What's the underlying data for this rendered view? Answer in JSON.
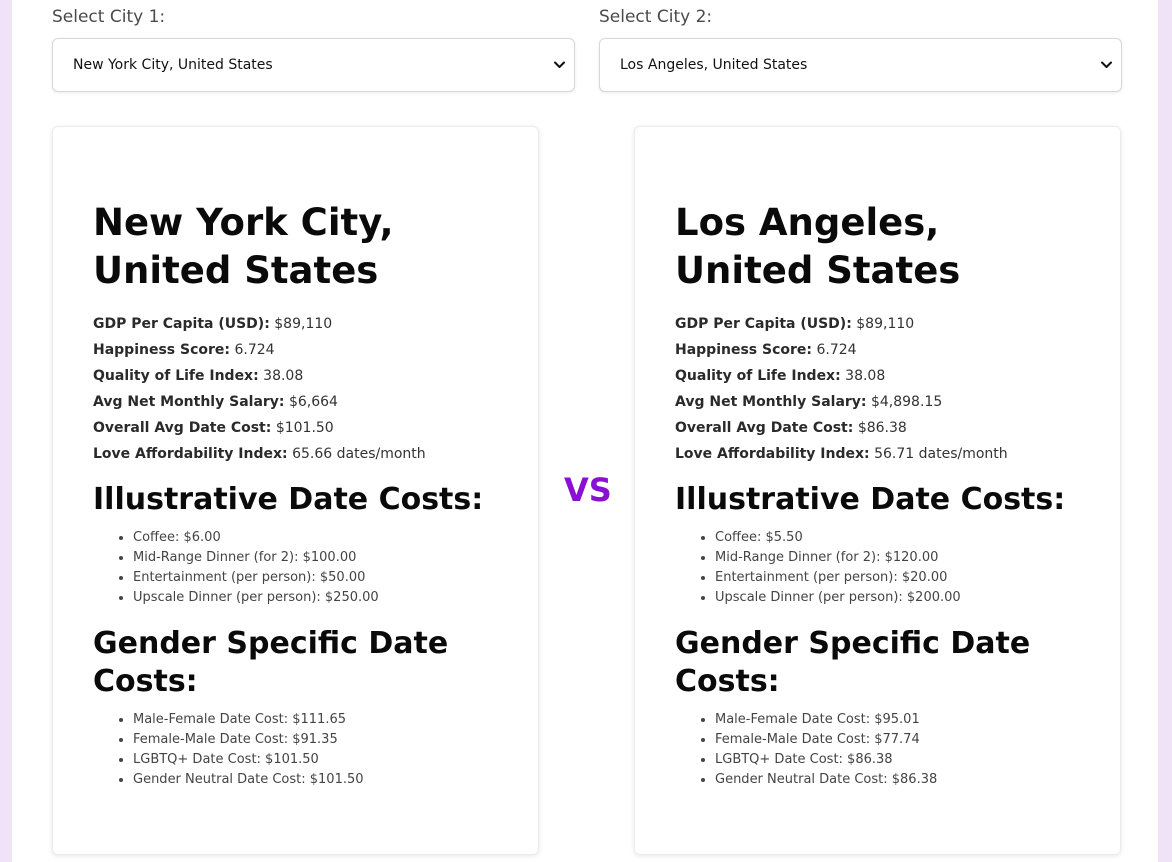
{
  "selectors": [
    {
      "label": "Select City 1:",
      "value": "New York City, United States"
    },
    {
      "label": "Select City 2:",
      "value": "Los Angeles, United States"
    }
  ],
  "vs_label": "VS",
  "colors": {
    "accent": "#8a11d4",
    "page_edge": "#f1e3f7"
  },
  "cities": [
    {
      "title": "New York City, United States",
      "stats": [
        {
          "label": "GDP Per Capita (USD):",
          "value": "$89,110"
        },
        {
          "label": "Happiness Score:",
          "value": "6.724"
        },
        {
          "label": "Quality of Life Index:",
          "value": "38.08"
        },
        {
          "label": "Avg Net Monthly Salary:",
          "value": "$6,664"
        },
        {
          "label": "Overall Avg Date Cost:",
          "value": "$101.50"
        },
        {
          "label": "Love Affordability Index:",
          "value": "65.66 dates/month"
        }
      ],
      "illustrative_title": "Illustrative Date Costs:",
      "illustrative": [
        "Coffee: $6.00",
        "Mid-Range Dinner (for 2): $100.00",
        "Entertainment (per person): $50.00",
        "Upscale Dinner (per person): $250.00"
      ],
      "gender_title": "Gender Specific Date Costs:",
      "gender": [
        "Male-Female Date Cost: $111.65",
        "Female-Male Date Cost: $91.35",
        "LGBTQ+ Date Cost: $101.50",
        "Gender Neutral Date Cost: $101.50"
      ]
    },
    {
      "title": "Los Angeles, United States",
      "stats": [
        {
          "label": "GDP Per Capita (USD):",
          "value": "$89,110"
        },
        {
          "label": "Happiness Score:",
          "value": "6.724"
        },
        {
          "label": "Quality of Life Index:",
          "value": "38.08"
        },
        {
          "label": "Avg Net Monthly Salary:",
          "value": "$4,898.15"
        },
        {
          "label": "Overall Avg Date Cost:",
          "value": "$86.38"
        },
        {
          "label": "Love Affordability Index:",
          "value": "56.71 dates/month"
        }
      ],
      "illustrative_title": "Illustrative Date Costs:",
      "illustrative": [
        "Coffee: $5.50",
        "Mid-Range Dinner (for 2): $120.00",
        "Entertainment (per person): $20.00",
        "Upscale Dinner (per person): $200.00"
      ],
      "gender_title": "Gender Specific Date Costs:",
      "gender": [
        "Male-Female Date Cost: $95.01",
        "Female-Male Date Cost: $77.74",
        "LGBTQ+ Date Cost: $86.38",
        "Gender Neutral Date Cost: $86.38"
      ]
    }
  ]
}
